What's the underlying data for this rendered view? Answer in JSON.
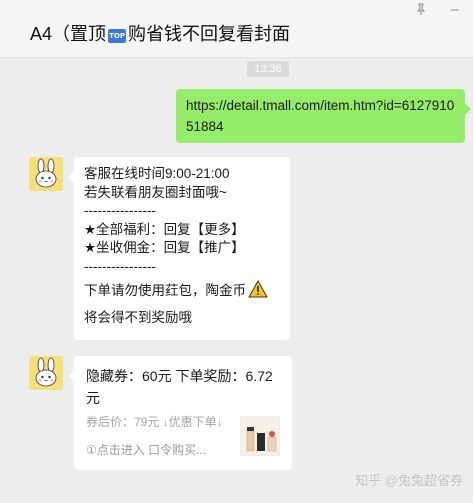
{
  "window": {
    "title_prefix": "A4（置顶",
    "title_badge": "TOP",
    "title_suffix": "购省钱不回复看封面",
    "pin_icon": "pin-icon",
    "minimize_icon": "minimize-icon"
  },
  "timestamp": "13:36",
  "messages": {
    "outgoing": {
      "text": "https://detail.tmall.com/item.htm?id=612791051884"
    },
    "incoming_text": {
      "lines": [
        "客服在线时间9:00-21:00",
        "若失联看朋友圈封面哦~",
        "----------------",
        "★全部福利：回复【更多】",
        "★坐收佣金：回复【推广】",
        "----------------",
        "下单请勿使用荭包，陶金币",
        "将会得不到奖励哦"
      ],
      "warning_icon": "warning-icon"
    },
    "card": {
      "title": "隐藏券：60元 下单奖励：6.72元",
      "price_line": "券后价：79元 ↓优惠下单↓",
      "footer": "①点击进入 口令购买...",
      "thumbnail_icon": "product-thumbnail"
    }
  },
  "watermark": "知乎 @兔兔超省券",
  "colors": {
    "background": "#ededed",
    "outgoing_bubble": "#95ec69",
    "incoming_bubble": "#ffffff",
    "avatar": "#f4e07a",
    "warning": "#f5c518"
  }
}
